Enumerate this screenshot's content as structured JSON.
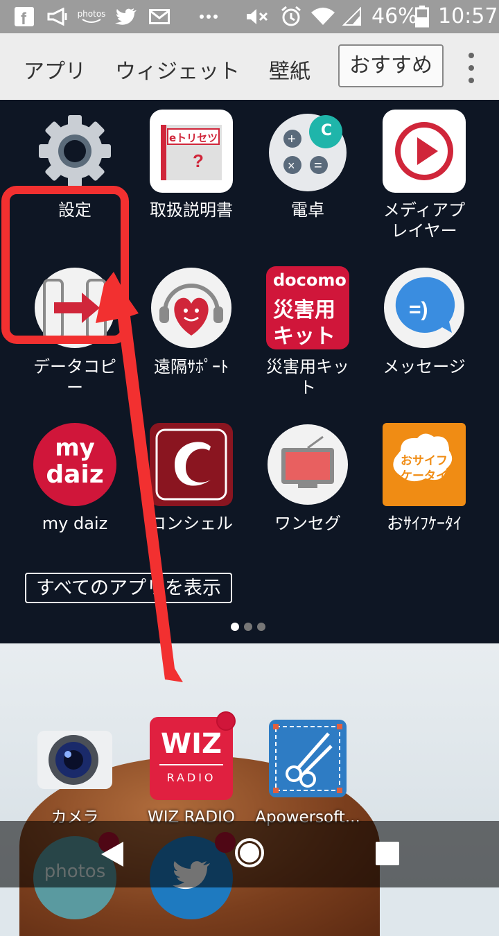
{
  "status_bar": {
    "icons": [
      "facebook-icon",
      "megaphone-icon",
      "amazon-photos-icon",
      "twitter-icon",
      "mail-icon",
      "more-dots-icon",
      "mute-icon",
      "alarm-icon",
      "wifi-icon",
      "signal-icon",
      "battery-icon"
    ],
    "battery": "46%",
    "time": "10:57"
  },
  "tabs": {
    "apps": "アプリ",
    "widgets": "ウィジェット",
    "wallpaper": "壁紙",
    "recommended": "おすすめ"
  },
  "apps": [
    {
      "label": "設定"
    },
    {
      "label": "取扱説明書"
    },
    {
      "label": "電卓"
    },
    {
      "label": "メディアプ\nレイヤー"
    },
    {
      "label": "データコピ\nー"
    },
    {
      "label": "遠隔ｻﾎﾟｰﾄ"
    },
    {
      "label": "災害用キッ\nト"
    },
    {
      "label": "メッセージ"
    },
    {
      "label": "my daiz"
    },
    {
      "label": "コンシェル"
    },
    {
      "label": "ワンセグ"
    },
    {
      "label": "おｻｲﾌｹｰﾀｲ"
    }
  ],
  "icon_text": {
    "etorisetsu": "eトリセツ",
    "calc_c": "C",
    "docomo": "docomo",
    "saigai": "災害用",
    "kit": "キット",
    "mydaiz_1": "my",
    "mydaiz_2": "daiz",
    "osaifu_1": "おサイフ",
    "osaifu_2": "ケータイ",
    "wiz": "WIZ",
    "radio": "RADIO",
    "photos": "photos"
  },
  "show_all": "すべてのアプリを表示",
  "page_dots": {
    "count": 3,
    "active": 0
  },
  "dock": [
    {
      "label": "カメラ"
    },
    {
      "label": "WIZ RADIO"
    },
    {
      "label": "Apowersoft..."
    }
  ],
  "colors": {
    "highlight": "#f23030",
    "panel": "#0e1624",
    "status_bar": "#9c9c9c",
    "tab_bar": "#ededed"
  }
}
